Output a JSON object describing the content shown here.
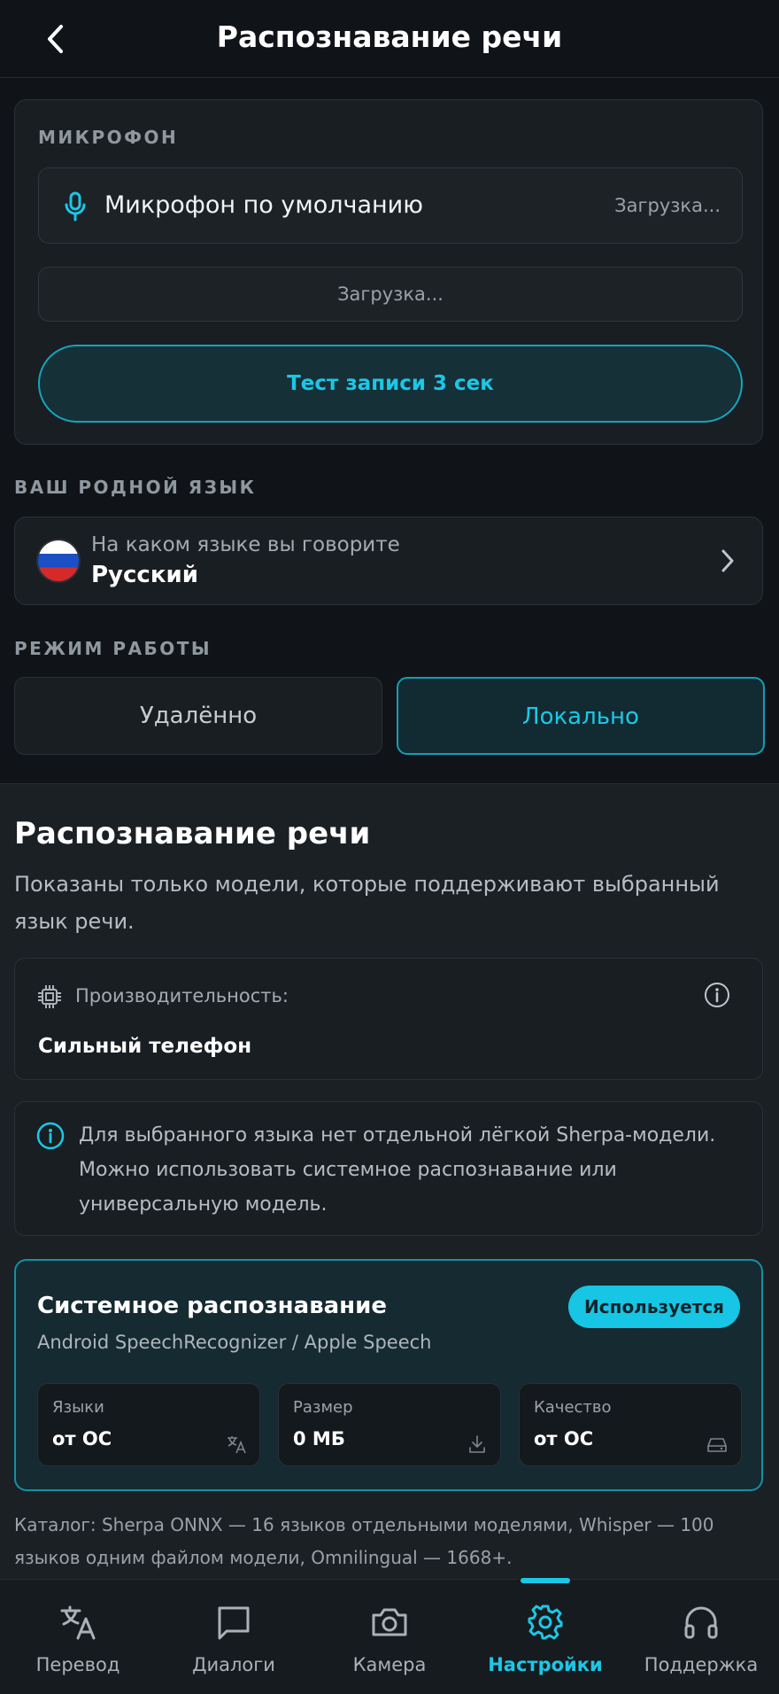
{
  "header": {
    "title": "Распознавание речи"
  },
  "microphone": {
    "section_label": "МИКРОФОН",
    "device_name": "Микрофон по умолчанию",
    "device_status": "Загрузка...",
    "loading_text": "Загрузка...",
    "test_button": "Тест записи 3 сек"
  },
  "language": {
    "section_label": "ВАШ РОДНОЙ ЯЗЫК",
    "hint": "На каком языке вы говорите",
    "value": "Русский"
  },
  "mode": {
    "section_label": "РЕЖИМ РАБОТЫ",
    "remote": "Удалённо",
    "local": "Локально",
    "selected": "local"
  },
  "asr": {
    "title": "Распознавание речи",
    "description": "Показаны только модели, которые поддерживают выбранный язык речи.",
    "performance_label": "Производительность:",
    "performance_value": "Сильный телефон",
    "notice": "Для выбранного языка нет отдельной лёгкой Sherpa-модели. Можно использовать системное распознавание или универсальную модель.",
    "system_card": {
      "title": "Системное распознавание",
      "subtitle": "Android SpeechRecognizer / Apple Speech",
      "badge": "Используется",
      "stats": [
        {
          "label": "Языки",
          "value": "от ОС",
          "icon": "translate-icon"
        },
        {
          "label": "Размер",
          "value": "0 МБ",
          "icon": "download-icon"
        },
        {
          "label": "Качество",
          "value": "от ОС",
          "icon": "storage-icon"
        }
      ]
    },
    "catalog": "Каталог: Sherpa ONNX — 16 языков отдельными моделями, Whisper — 100 языков одним файлом модели, Omnilingual — 1668+."
  },
  "tabbar": {
    "tabs": [
      {
        "label": "Перевод",
        "icon": "translate-icon"
      },
      {
        "label": "Диалоги",
        "icon": "chat-icon"
      },
      {
        "label": "Камера",
        "icon": "camera-icon"
      },
      {
        "label": "Настройки",
        "icon": "gear-icon",
        "active": true
      },
      {
        "label": "Поддержка",
        "icon": "headphones-icon"
      }
    ]
  },
  "colors": {
    "accent": "#1cc7e6",
    "background": "#101418",
    "card": "#191e22"
  }
}
